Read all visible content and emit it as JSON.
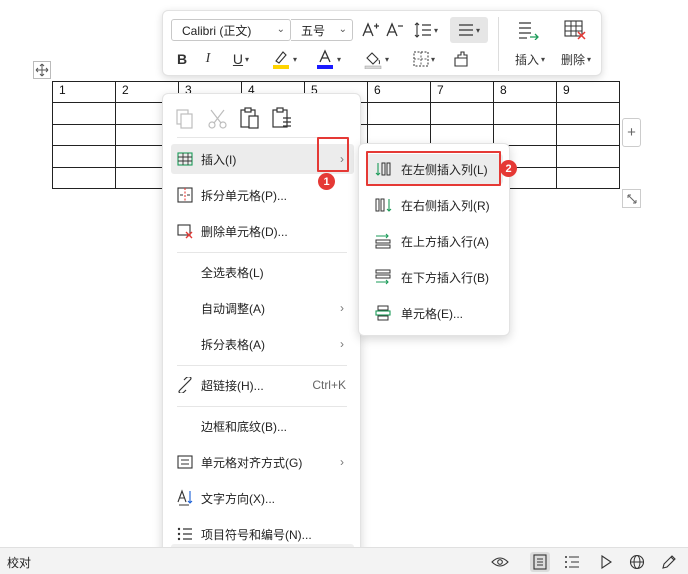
{
  "toolbar": {
    "font_name": "Calibri (正文)",
    "font_size": "五号",
    "insert_label": "插入",
    "delete_label": "删除"
  },
  "table": {
    "header_row": [
      "1",
      "2",
      "3",
      "4",
      "5",
      "6",
      "7",
      "8",
      "9"
    ],
    "empty_rows": 4
  },
  "context_menu": {
    "items": [
      {
        "label": "插入(I)",
        "icon": "table-insert-icon",
        "submenu": true
      },
      {
        "label": "拆分单元格(P)...",
        "icon": "split-cell-icon"
      },
      {
        "label": "删除单元格(D)...",
        "icon": "delete-cell-icon"
      },
      {
        "label": "全选表格(L)"
      },
      {
        "label": "自动调整(A)",
        "submenu": true
      },
      {
        "label": "拆分表格(A)",
        "submenu": true
      },
      {
        "label": "超链接(H)...",
        "icon": "hyperlink-icon",
        "shortcut": "Ctrl+K"
      },
      {
        "label": "边框和底纹(B)..."
      },
      {
        "label": "单元格对齐方式(G)",
        "icon": "cell-align-icon",
        "submenu": true
      },
      {
        "label": "文字方向(X)...",
        "icon": "text-direction-icon"
      },
      {
        "label": "项目符号和编号(N)...",
        "icon": "bullets-numbering-icon"
      }
    ]
  },
  "submenu": {
    "items": [
      {
        "label": "在左侧插入列(L)",
        "icon": "insert-column-left-icon"
      },
      {
        "label": "在右侧插入列(R)",
        "icon": "insert-column-right-icon"
      },
      {
        "label": "在上方插入行(A)",
        "icon": "insert-row-above-icon"
      },
      {
        "label": "在下方插入行(B)",
        "icon": "insert-row-below-icon"
      },
      {
        "label": "单元格(E)...",
        "icon": "insert-cell-icon"
      }
    ]
  },
  "badges": [
    "1",
    "2"
  ],
  "statusbar": {
    "proofread_label": "校对"
  },
  "colors": {
    "highlight": "#e53935",
    "font_color_bar": "#1a1aff",
    "highlighter_bar": "#ffd400"
  }
}
